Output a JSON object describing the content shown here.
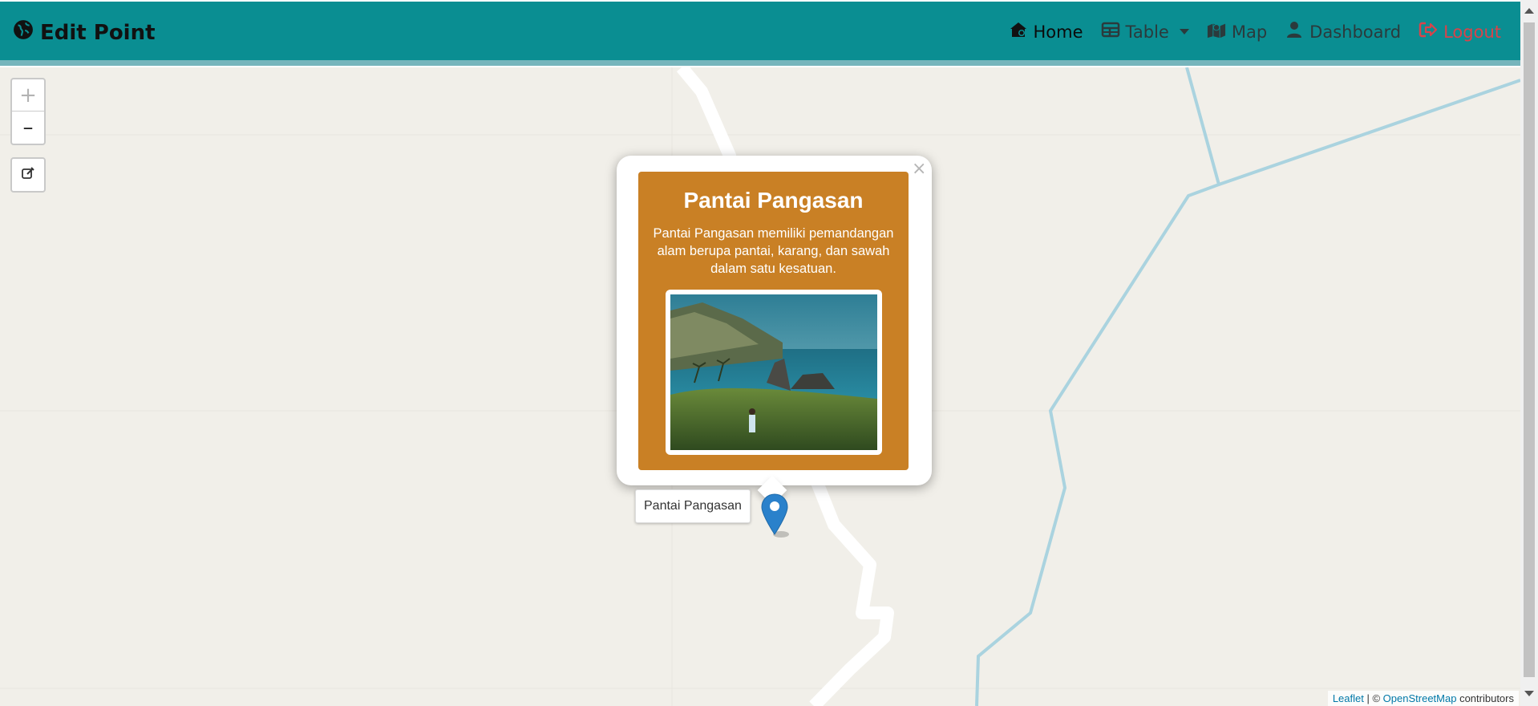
{
  "navbar": {
    "brand": "Edit Point",
    "items": [
      {
        "label": "Home",
        "icon": "home-icon"
      },
      {
        "label": "Table",
        "icon": "table-icon"
      },
      {
        "label": "Map",
        "icon": "map-icon"
      },
      {
        "label": "Dashboard",
        "icon": "user-icon"
      },
      {
        "label": "Logout",
        "icon": "logout-icon"
      }
    ],
    "colors": {
      "background": "#0a8e92",
      "logout": "#d9434a"
    }
  },
  "map": {
    "zoom_in": "+",
    "zoom_out": "–",
    "attribution": {
      "leaflet": "Leaflet",
      "separator": " | © ",
      "osm": "OpenStreetMap",
      "suffix": " contributors"
    }
  },
  "popup": {
    "close": "×",
    "title": "Pantai Pangasan",
    "description": "Pantai Pangasan memiliki pemandangan alam berupa pantai, karang, dan sawah dalam satu kesatuan.",
    "card_color": "#c98025"
  },
  "marker": {
    "label": "Pantai Pangasan",
    "color": "#2a81cb"
  }
}
